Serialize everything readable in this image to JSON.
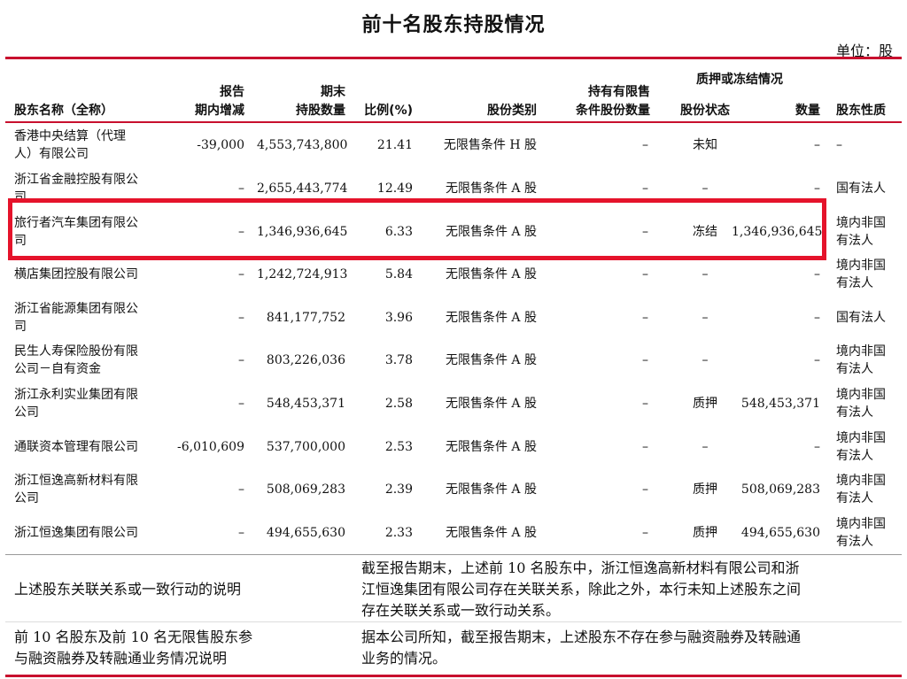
{
  "title": "前十名股东持股情况",
  "unit": "单位：股",
  "headers": {
    "name": "股东名称（全称）",
    "change1": "报告",
    "change2": "期内增减",
    "qty1": "期末",
    "qty2": "持股数量",
    "pct": "比例(%)",
    "cls": "股份类别",
    "restricted1": "持有有限售",
    "restricted2": "条件股份数量",
    "pledge_group": "质押或冻结情况",
    "pstatus": "股份状态",
    "pqty": "数量",
    "nature": "股东性质"
  },
  "rows": [
    {
      "name": [
        "香港中央结算（代理",
        "人）有限公司"
      ],
      "change": "-39,000",
      "qty": "4,553,743,800",
      "pct": "21.41",
      "cls": "无限售条件 H 股",
      "restricted": "–",
      "pstatus": "未知",
      "pqty": "–",
      "nature": [
        "–"
      ]
    },
    {
      "name": [
        "浙江省金融控股有限公",
        "司"
      ],
      "change": "–",
      "qty": "2,655,443,774",
      "pct": "12.49",
      "cls": "无限售条件 A 股",
      "restricted": "–",
      "pstatus": "–",
      "pqty": "–",
      "nature": [
        "国有法人"
      ]
    },
    {
      "name": [
        "旅行者汽车集团有限公",
        "司"
      ],
      "change": "–",
      "qty": "1,346,936,645",
      "pct": "6.33",
      "cls": "无限售条件 A 股",
      "restricted": "–",
      "pstatus": "冻结",
      "pqty": "1,346,936,645",
      "nature": [
        "境内非国",
        "有法人"
      ]
    },
    {
      "name": [
        "横店集团控股有限公司"
      ],
      "change": "–",
      "qty": "1,242,724,913",
      "pct": "5.84",
      "cls": "无限售条件 A 股",
      "restricted": "–",
      "pstatus": "–",
      "pqty": "–",
      "nature": [
        "境内非国",
        "有法人"
      ]
    },
    {
      "name": [
        "浙江省能源集团有限公",
        "司"
      ],
      "change": "–",
      "qty": "841,177,752",
      "pct": "3.96",
      "cls": "无限售条件 A 股",
      "restricted": "–",
      "pstatus": "–",
      "pqty": "–",
      "nature": [
        "国有法人"
      ]
    },
    {
      "name": [
        "民生人寿保险股份有限",
        "公司－自有资金"
      ],
      "change": "–",
      "qty": "803,226,036",
      "pct": "3.78",
      "cls": "无限售条件 A 股",
      "restricted": "–",
      "pstatus": "–",
      "pqty": "–",
      "nature": [
        "境内非国",
        "有法人"
      ]
    },
    {
      "name": [
        "浙江永利实业集团有限",
        "公司"
      ],
      "change": "–",
      "qty": "548,453,371",
      "pct": "2.58",
      "cls": "无限售条件 A 股",
      "restricted": "–",
      "pstatus": "质押",
      "pqty": "548,453,371",
      "nature": [
        "境内非国",
        "有法人"
      ]
    },
    {
      "name": [
        "通联资本管理有限公司"
      ],
      "change": "-6,010,609",
      "qty": "537,700,000",
      "pct": "2.53",
      "cls": "无限售条件 A 股",
      "restricted": "–",
      "pstatus": "–",
      "pqty": "–",
      "nature": [
        "境内非国",
        "有法人"
      ]
    },
    {
      "name": [
        "浙江恒逸高新材料有限",
        "公司"
      ],
      "change": "–",
      "qty": "508,069,283",
      "pct": "2.39",
      "cls": "无限售条件 A 股",
      "restricted": "–",
      "pstatus": "质押",
      "pqty": "508,069,283",
      "nature": [
        "境内非国",
        "有法人"
      ]
    },
    {
      "name": [
        "浙江恒逸集团有限公司"
      ],
      "change": "–",
      "qty": "494,655,630",
      "pct": "2.33",
      "cls": "无限售条件 A 股",
      "restricted": "–",
      "pstatus": "质押",
      "pqty": "494,655,630",
      "nature": [
        "境内非国",
        "有法人"
      ]
    }
  ],
  "notes": [
    {
      "label": [
        "上述股东关联关系或一致行动的说明"
      ],
      "text": [
        "截至报告期末，上述前 10 名股东中，浙江恒逸高新材料有限公司和浙",
        "江恒逸集团有限公司存在关联关系，除此之外，本行未知上述股东之间",
        "存在关联关系或一致行动关系。"
      ]
    },
    {
      "label": [
        "前 10 名股东及前 10 名无限售股东参",
        "与融资融券及转融通业务情况说明"
      ],
      "text": [
        "据本公司所知，截至报告期末，上述股东不存在参与融资融券及转融通",
        "业务的情况。"
      ]
    }
  ],
  "colors": {
    "accent": "#c8102e",
    "highlight": "#e5132b"
  }
}
